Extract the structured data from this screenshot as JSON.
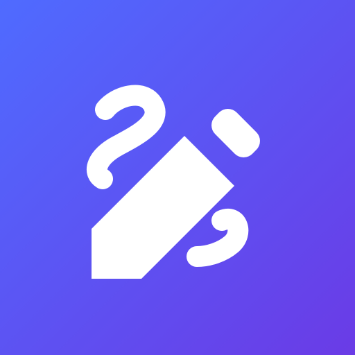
{
  "app_icon": {
    "icon": "pencil-squiggle-icon",
    "background_gradient": [
      "#4f6bff",
      "#6a3be6"
    ],
    "glyph_color": "#ffffff"
  }
}
